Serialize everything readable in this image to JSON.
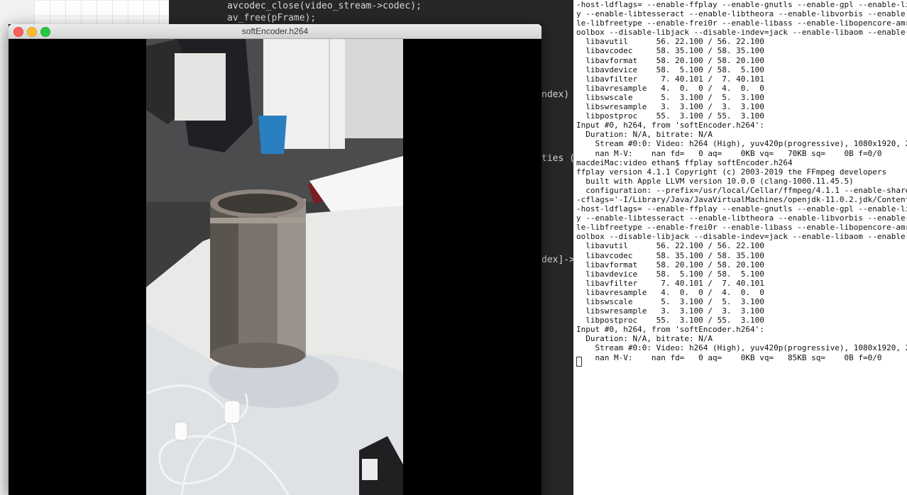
{
  "window": {
    "title": "softEncoder.h264"
  },
  "code_editor": {
    "lines": [
      "avcodec_close(video_stream->codec);",
      "av_free(pFrame);"
    ],
    "fragments": [
      "ndex)",
      "ties (",
      "dex]->"
    ]
  },
  "terminal": {
    "lines": [
      "-host-ldflags= --enable-ffplay --enable-gnutls --enable-gpl --enable-li",
      "y --enable-libtesseract --enable-libtheora --enable-libvorbis --enable-",
      "le-libfreetype --enable-frei0r --enable-libass --enable-libopencore-amr",
      "oolbox --disable-libjack --disable-indev=jack --enable-libaom --enable-",
      "  libavutil      56. 22.100 / 56. 22.100",
      "  libavcodec     58. 35.100 / 58. 35.100",
      "  libavformat    58. 20.100 / 58. 20.100",
      "  libavdevice    58.  5.100 / 58.  5.100",
      "  libavfilter     7. 40.101 /  7. 40.101",
      "  libavresample   4.  0.  0 /  4.  0.  0",
      "  libswscale      5.  3.100 /  5.  3.100",
      "  libswresample   3.  3.100 /  3.  3.100",
      "  libpostproc    55.  3.100 / 55.  3.100",
      "Input #0, h264, from 'softEncoder.h264':",
      "  Duration: N/A, bitrate: N/A",
      "    Stream #0:0: Video: h264 (High), yuv420p(progressive), 1080x1920, 2",
      "    nan M-V:    nan fd=   0 aq=    0KB vq=   70KB sq=    0B f=0/0",
      "macdeiMac:video ethan$ ffplay softEncoder.h264",
      "ffplay version 4.1.1 Copyright (c) 2003-2019 the FFmpeg developers",
      "  built with Apple LLVM version 10.0.0 (clang-1000.11.45.5)",
      "  configuration: --prefix=/usr/local/Cellar/ffmpeg/4.1.1 --enable-share",
      "-cflags='-I/Library/Java/JavaVirtualMachines/openjdk-11.0.2.jdk/Content",
      "-host-ldflags= --enable-ffplay --enable-gnutls --enable-gpl --enable-li",
      "y --enable-libtesseract --enable-libtheora --enable-libvorbis --enable-",
      "le-libfreetype --enable-frei0r --enable-libass --enable-libopencore-amr",
      "oolbox --disable-libjack --disable-indev=jack --enable-libaom --enable-",
      "  libavutil      56. 22.100 / 56. 22.100",
      "  libavcodec     58. 35.100 / 58. 35.100",
      "  libavformat    58. 20.100 / 58. 20.100",
      "  libavdevice    58.  5.100 / 58.  5.100",
      "  libavfilter     7. 40.101 /  7. 40.101",
      "  libavresample   4.  0.  0 /  4.  0.  0",
      "  libswscale      5.  3.100 /  5.  3.100",
      "  libswresample   3.  3.100 /  3.  3.100",
      "  libpostproc    55.  3.100 / 55.  3.100",
      "Input #0, h264, from 'softEncoder.h264':",
      "  Duration: N/A, bitrate: N/A",
      "    Stream #0:0: Video: h264 (High), yuv420p(progressive), 1080x1920, 2",
      "    nan M-V:    nan fd=   0 aq=    0KB vq=   85KB sq=    0B f=0/0"
    ]
  },
  "colors": {
    "close": "#fc5f57",
    "minimize": "#fdbc2e",
    "zoom": "#28c840"
  }
}
